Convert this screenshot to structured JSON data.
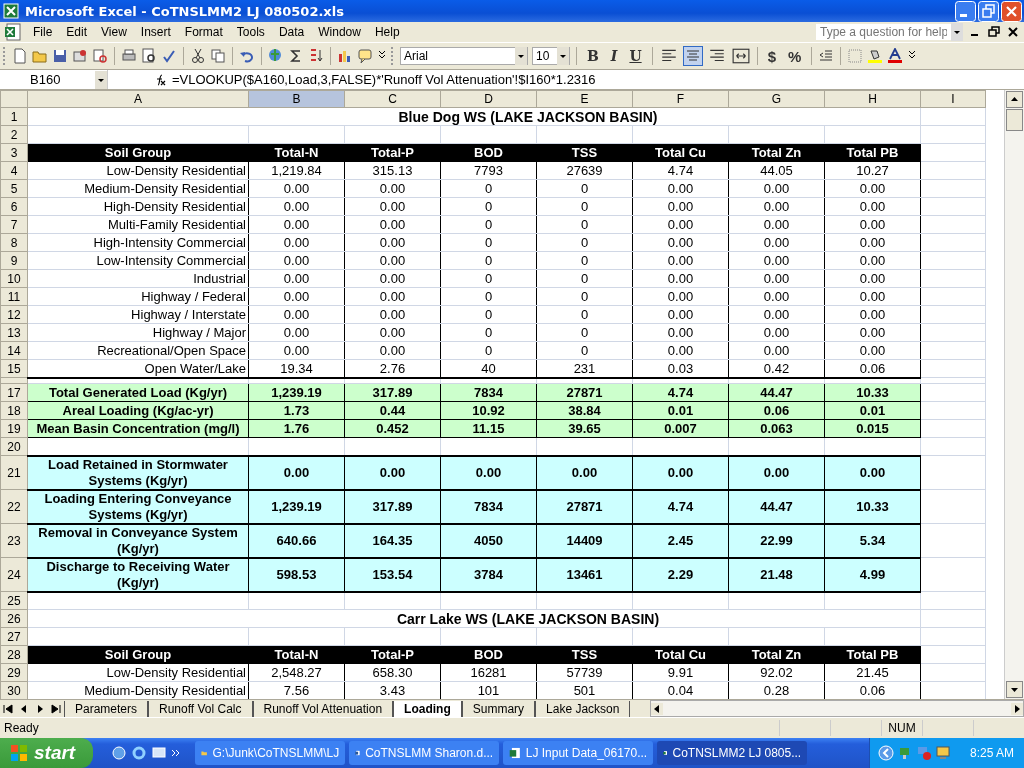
{
  "window": {
    "title": "Microsoft Excel - CoTNSLMM2 LJ 080502.xls"
  },
  "menu": [
    "File",
    "Edit",
    "View",
    "Insert",
    "Format",
    "Tools",
    "Data",
    "Window",
    "Help"
  ],
  "help_box": {
    "placeholder": "Type a question for help"
  },
  "toolbar": {
    "font": "Arial",
    "size": "10",
    "format_buttons": [
      "B",
      "I",
      "U"
    ],
    "align": [
      {
        "kind": "left",
        "selected": false
      },
      {
        "kind": "center",
        "selected": true
      },
      {
        "kind": "right",
        "selected": false
      },
      {
        "kind": "merge",
        "selected": false
      }
    ],
    "number_buttons": [
      "$",
      "%"
    ]
  },
  "name_box": "B160",
  "formula": "=VLOOKUP($A160,Load,3,FALSE)*'Runoff Vol Attenuation'!$I160*1.2316",
  "columns": [
    {
      "label": "A",
      "selected": false
    },
    {
      "label": "B",
      "selected": true
    },
    {
      "label": "C",
      "selected": false
    },
    {
      "label": "D",
      "selected": false
    },
    {
      "label": "E",
      "selected": false
    },
    {
      "label": "F",
      "selected": false
    },
    {
      "label": "G",
      "selected": false
    },
    {
      "label": "H",
      "selected": false
    },
    {
      "label": "I",
      "selected": false
    }
  ],
  "rows": [
    {
      "num": "1",
      "kind": "title",
      "cells": [
        "Blue Dog WS (LAKE JACKSON BASIN)"
      ]
    },
    {
      "num": "2",
      "kind": "blank"
    },
    {
      "num": "3",
      "kind": "header",
      "cells": [
        "Soil Group",
        "Total-N",
        "Total-P",
        "BOD",
        "TSS",
        "Total Cu",
        "Total Zn",
        "Total PB"
      ]
    },
    {
      "num": "4",
      "kind": "data",
      "cells": [
        "Low-Density Residential",
        "1,219.84",
        "315.13",
        "7793",
        "27639",
        "4.74",
        "44.05",
        "10.27"
      ]
    },
    {
      "num": "5",
      "kind": "data",
      "cells": [
        "Medium-Density Residential",
        "0.00",
        "0.00",
        "0",
        "0",
        "0.00",
        "0.00",
        "0.00"
      ]
    },
    {
      "num": "6",
      "kind": "data",
      "cells": [
        "High-Density Residential",
        "0.00",
        "0.00",
        "0",
        "0",
        "0.00",
        "0.00",
        "0.00"
      ]
    },
    {
      "num": "7",
      "kind": "data",
      "cells": [
        "Multi-Family Residential",
        "0.00",
        "0.00",
        "0",
        "0",
        "0.00",
        "0.00",
        "0.00"
      ]
    },
    {
      "num": "8",
      "kind": "data",
      "cells": [
        "High-Intensity Commercial",
        "0.00",
        "0.00",
        "0",
        "0",
        "0.00",
        "0.00",
        "0.00"
      ]
    },
    {
      "num": "9",
      "kind": "data",
      "cells": [
        "Low-Intensity Commercial",
        "0.00",
        "0.00",
        "0",
        "0",
        "0.00",
        "0.00",
        "0.00"
      ]
    },
    {
      "num": "10",
      "kind": "data",
      "cells": [
        "Industrial",
        "0.00",
        "0.00",
        "0",
        "0",
        "0.00",
        "0.00",
        "0.00"
      ]
    },
    {
      "num": "11",
      "kind": "data",
      "cells": [
        "Highway / Federal",
        "0.00",
        "0.00",
        "0",
        "0",
        "0.00",
        "0.00",
        "0.00"
      ]
    },
    {
      "num": "12",
      "kind": "data",
      "cells": [
        "Highway / Interstate",
        "0.00",
        "0.00",
        "0",
        "0",
        "0.00",
        "0.00",
        "0.00"
      ]
    },
    {
      "num": "13",
      "kind": "data",
      "cells": [
        "Highway / Major",
        "0.00",
        "0.00",
        "0",
        "0",
        "0.00",
        "0.00",
        "0.00"
      ]
    },
    {
      "num": "14",
      "kind": "data",
      "cells": [
        "Recreational/Open Space",
        "0.00",
        "0.00",
        "0",
        "0",
        "0.00",
        "0.00",
        "0.00"
      ]
    },
    {
      "num": "15",
      "kind": "data",
      "cells": [
        "Open Water/Lake",
        "19.34",
        "2.76",
        "40",
        "231",
        "0.03",
        "0.42",
        "0.06"
      ]
    },
    {
      "kind": "thin"
    },
    {
      "num": "17",
      "kind": "summary",
      "cells": [
        "Total Generated Load (Kg/yr)",
        "1,239.19",
        "317.89",
        "7834",
        "27871",
        "4.74",
        "44.47",
        "10.33"
      ]
    },
    {
      "num": "18",
      "kind": "summary",
      "cells": [
        "Areal Loading (Kg/ac-yr)",
        "1.73",
        "0.44",
        "10.92",
        "38.84",
        "0.01",
        "0.06",
        "0.01"
      ]
    },
    {
      "num": "19",
      "kind": "summary",
      "cells": [
        "Mean Basin Concentration (mg/l)",
        "1.76",
        "0.452",
        "11.15",
        "39.65",
        "0.007",
        "0.063",
        "0.015"
      ]
    },
    {
      "num": "20",
      "kind": "blank"
    },
    {
      "num": "21",
      "kind": "retention",
      "cells": [
        "Load Retained in Stormwater Systems (Kg/yr)",
        "0.00",
        "0.00",
        "0.00",
        "0.00",
        "0.00",
        "0.00",
        "0.00"
      ]
    },
    {
      "num": "22",
      "kind": "retention",
      "cells": [
        "Loading Entering Conveyance Systems (Kg/yr)",
        "1,239.19",
        "317.89",
        "7834",
        "27871",
        "4.74",
        "44.47",
        "10.33"
      ]
    },
    {
      "num": "23",
      "kind": "retention",
      "cells": [
        "Removal in Conveyance System (Kg/yr)",
        "640.66",
        "164.35",
        "4050",
        "14409",
        "2.45",
        "22.99",
        "5.34"
      ]
    },
    {
      "num": "24",
      "kind": "retention",
      "cells": [
        "Discharge to Receiving Water (Kg/yr)",
        "598.53",
        "153.54",
        "3784",
        "13461",
        "2.29",
        "21.48",
        "4.99"
      ]
    },
    {
      "num": "25",
      "kind": "blank"
    },
    {
      "num": "26",
      "kind": "title",
      "cells": [
        "Carr Lake WS (LAKE JACKSON BASIN)"
      ]
    },
    {
      "num": "27",
      "kind": "blank"
    },
    {
      "num": "28",
      "kind": "header",
      "cells": [
        "Soil Group",
        "Total-N",
        "Total-P",
        "BOD",
        "TSS",
        "Total Cu",
        "Total Zn",
        "Total PB"
      ]
    },
    {
      "num": "29",
      "kind": "data",
      "cells": [
        "Low-Density Residential",
        "2,548.27",
        "658.30",
        "16281",
        "57739",
        "9.91",
        "92.02",
        "21.45"
      ]
    },
    {
      "num": "30",
      "kind": "data",
      "cells": [
        "Medium-Density Residential",
        "7.56",
        "3.43",
        "101",
        "501",
        "0.04",
        "0.28",
        "0.06"
      ]
    }
  ],
  "sheet_tabs": [
    {
      "label": "Parameters",
      "selected": false
    },
    {
      "label": "Runoff Vol Calc",
      "selected": false
    },
    {
      "label": "Runoff Vol Attenuation",
      "selected": false
    },
    {
      "label": "Loading",
      "selected": true
    },
    {
      "label": "Summary",
      "selected": false
    },
    {
      "label": "Lake Jackson",
      "selected": false
    }
  ],
  "status_bar": {
    "mode": "Ready",
    "num_lock": "NUM"
  },
  "taskbar": {
    "start": "start",
    "tasks": [
      {
        "label": "G:\\Junk\\CoTNSLMM\\LJ",
        "kind": "folder",
        "selected": false
      },
      {
        "label": "CoTNSLMM Sharon.d...",
        "kind": "word",
        "selected": false
      },
      {
        "label": "LJ Input Data_06170...",
        "kind": "excel",
        "selected": false
      },
      {
        "label": "CoTNSLMM2 LJ 0805...",
        "kind": "excel",
        "selected": true
      }
    ],
    "clock": "8:25 AM"
  }
}
